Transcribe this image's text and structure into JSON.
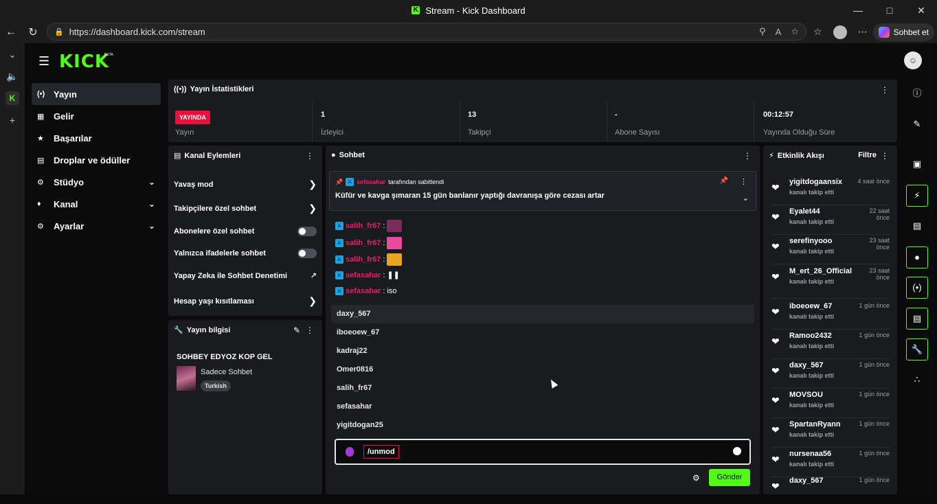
{
  "browser": {
    "title": "Stream - Kick Dashboard",
    "url": "https://dashboard.kick.com/stream",
    "copilot_label": "Sohbet et"
  },
  "app": {
    "logo": "KICK",
    "beta": "BETA"
  },
  "sidebar": {
    "items": [
      {
        "label": "Yayın",
        "icon": "broadcast-icon"
      },
      {
        "label": "Gelir",
        "icon": "revenue-icon"
      },
      {
        "label": "Başarılar",
        "icon": "trophy-icon"
      },
      {
        "label": "Droplar ve ödüller",
        "icon": "gift-icon"
      },
      {
        "label": "Stüdyo",
        "icon": "studio-icon"
      },
      {
        "label": "Kanal",
        "icon": "channel-icon"
      },
      {
        "label": "Ayarlar",
        "icon": "gear-icon"
      }
    ]
  },
  "stats": {
    "title": "Yayın İstatistikleri",
    "live_badge": "YAYINDA",
    "items": [
      {
        "value": "",
        "label": "Yayın"
      },
      {
        "value": "1",
        "label": "İzleyici"
      },
      {
        "value": "13",
        "label": "Takipçi"
      },
      {
        "value": "-",
        "label": "Abone Sayısı"
      },
      {
        "value": "00:12:57",
        "label": "Yayında Olduğu Süre"
      }
    ]
  },
  "channel_actions": {
    "title": "Kanal Eylemleri",
    "items": [
      {
        "label": "Yavaş mod",
        "control": "arrow"
      },
      {
        "label": "Takipçilere özel sohbet",
        "control": "arrow"
      },
      {
        "label": "Abonelere özel sohbet",
        "control": "toggle"
      },
      {
        "label": "Yalnızca ifadelerle sohbet",
        "control": "toggle"
      },
      {
        "label": "Yapay Zeka ile Sohbet Denetimi",
        "control": "external"
      },
      {
        "label": "Hesap yaşı kısıtlaması",
        "control": "arrow"
      }
    ]
  },
  "stream_info": {
    "title": "Yayın bilgisi",
    "stream_title": "SOHBEY EDYOZ KOP GEL",
    "category": "Sadece Sohbet",
    "language": "Turkish"
  },
  "chat": {
    "title": "Sohbet",
    "pinned": {
      "author": "sefasahar",
      "suffix": "tarafından sabitlendi",
      "message": "Küfür ve kavga şımaran 15 gün banlanır yaptığı davranışa göre cezası artar"
    },
    "messages": [
      {
        "user": "salih_fr67",
        "text": ""
      },
      {
        "user": "salih_fr67",
        "text": ""
      },
      {
        "user": "salih_fr67",
        "text": ""
      },
      {
        "user": "sefasahar",
        "text": ""
      },
      {
        "user": "sefasahar",
        "text": "iso"
      }
    ],
    "suggestions": [
      "daxy_567",
      "iboeoew_67",
      "kadraj22",
      "Omer0816",
      "salih_fr67",
      "sefasahar",
      "yigitdogan25"
    ],
    "input_value": "/unmod",
    "send_label": "Gönder",
    "emote_colors": [
      "#7a2d5a",
      "#e84aa0",
      "#e8a520",
      "#ffffff"
    ]
  },
  "events": {
    "title": "Etkinlik Akışı",
    "filter_label": "Filtre",
    "items": [
      {
        "name": "yigitdogaansix",
        "sub": "kanalı takip etti",
        "time": "4 saat önce"
      },
      {
        "name": "Eyalet44",
        "sub": "kanalı takip etti",
        "time": "22 saat önce"
      },
      {
        "name": "serefinyooo",
        "sub": "kanalı takip etti",
        "time": "23 saat önce"
      },
      {
        "name": "M_ert_26_Official",
        "sub": "kanalı takip etti",
        "time": "23 saat önce"
      },
      {
        "name": "iboeoew_67",
        "sub": "kanalı takip etti",
        "time": "1 gün önce"
      },
      {
        "name": "Ramoo2432",
        "sub": "kanalı takip etti",
        "time": "1 gün önce"
      },
      {
        "name": "daxy_567",
        "sub": "kanalı takip etti",
        "time": "1 gün önce"
      },
      {
        "name": "MOVSOU",
        "sub": "kanalı takip etti",
        "time": "1 gün önce"
      },
      {
        "name": "SpartanRyann",
        "sub": "kanalı takip etti",
        "time": "1 gün önce"
      },
      {
        "name": "nursenaa56",
        "sub": "kanalı takip etti",
        "time": "1 gün önce"
      },
      {
        "name": "daxy_567",
        "sub": "",
        "time": "1 gün önce"
      }
    ]
  },
  "colors": {
    "brand": "#53fc18",
    "live": "#e9113c",
    "panel": "#191b1f",
    "mod_name": "#e91e63"
  }
}
